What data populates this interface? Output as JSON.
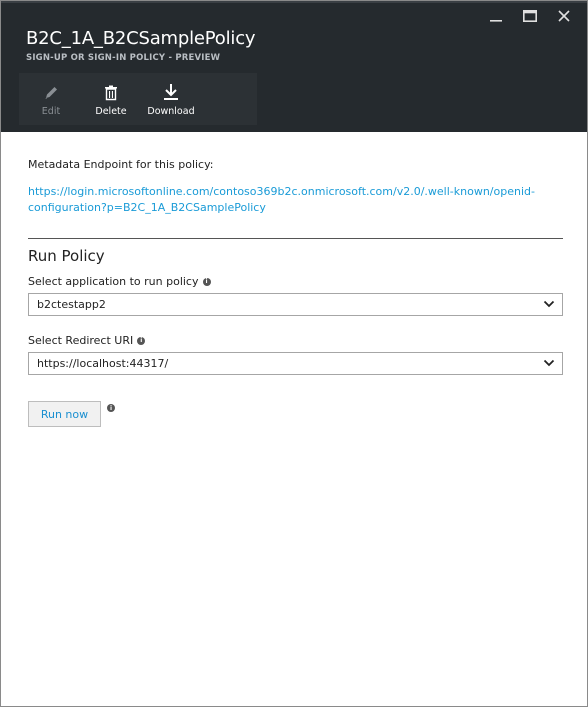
{
  "window": {
    "minimize_icon": "minimize-icon",
    "maximize_icon": "maximize-icon",
    "close_icon": "close-icon"
  },
  "header": {
    "title": "B2C_1A_B2CSamplePolicy",
    "subtitle": "SIGN-UP OR SIGN-IN POLICY - PREVIEW"
  },
  "commands": [
    {
      "label": "Edit",
      "icon": "pencil-icon",
      "enabled": false
    },
    {
      "label": "Delete",
      "icon": "trash-icon",
      "enabled": true
    },
    {
      "label": "Download",
      "icon": "download-icon",
      "enabled": true
    }
  ],
  "metadata": {
    "label": "Metadata Endpoint for this policy:",
    "url_line1": "https://login.microsoftonline.com/contoso369b2c.onmicrosoft.com/v2.0/.well-known/openid-",
    "url_line2": "configuration?p=B2C_1A_B2CSamplePolicy"
  },
  "run_policy": {
    "title": "Run Policy",
    "app_label": "Select application to run policy",
    "app_value": "b2ctestapp2",
    "redirect_label": "Select Redirect URI",
    "redirect_value": "https://localhost:44317/",
    "run_button": "Run now"
  },
  "colors": {
    "header_bg": "#252a2e",
    "link": "#1a9bd7",
    "button_text": "#1a8fd0"
  }
}
